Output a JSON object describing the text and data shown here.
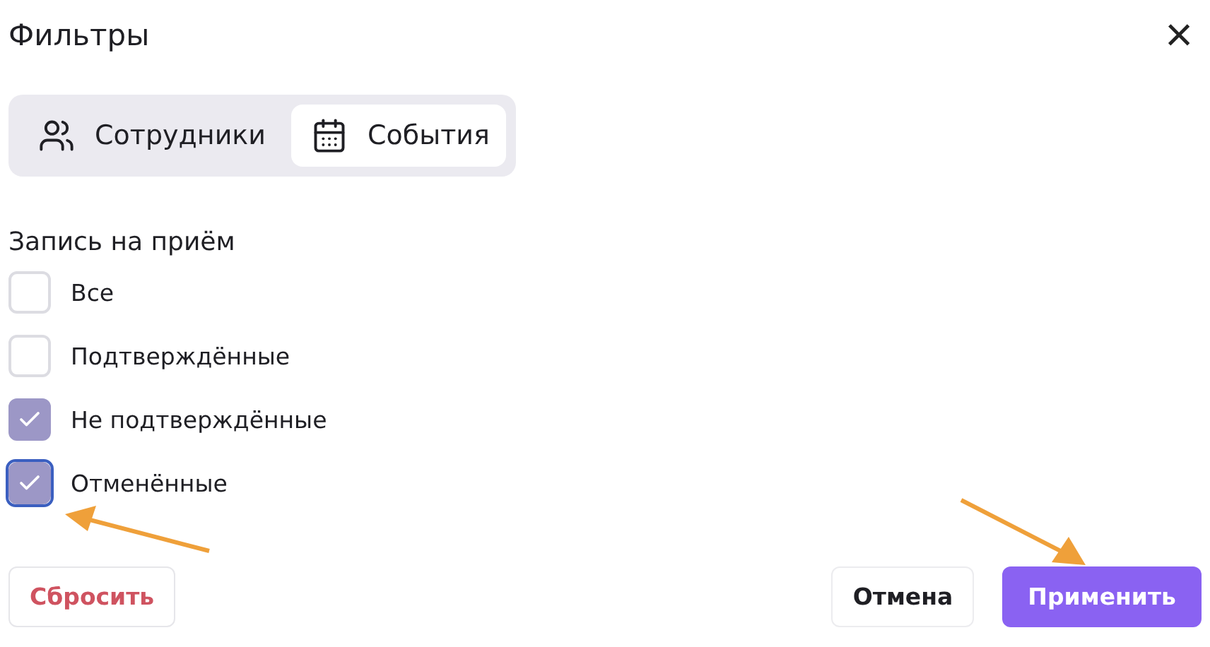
{
  "dialog": {
    "title": "Фильтры",
    "close": "×"
  },
  "tabs": [
    {
      "label": "Сотрудники",
      "selected": false
    },
    {
      "label": "События",
      "selected": true
    }
  ],
  "section": {
    "title": "Запись на приём",
    "options": [
      {
        "label": "Все",
        "checked": false,
        "focused": false
      },
      {
        "label": "Подтверждённые",
        "checked": false,
        "focused": false
      },
      {
        "label": "Не подтверждённые",
        "checked": true,
        "focused": false
      },
      {
        "label": "Отменённые",
        "checked": true,
        "focused": true
      }
    ]
  },
  "buttons": [
    {
      "label": "Сбросить",
      "kind": "reset"
    },
    {
      "label": "Отмена",
      "kind": "cancel"
    },
    {
      "label": "Применить",
      "kind": "primary"
    }
  ]
}
